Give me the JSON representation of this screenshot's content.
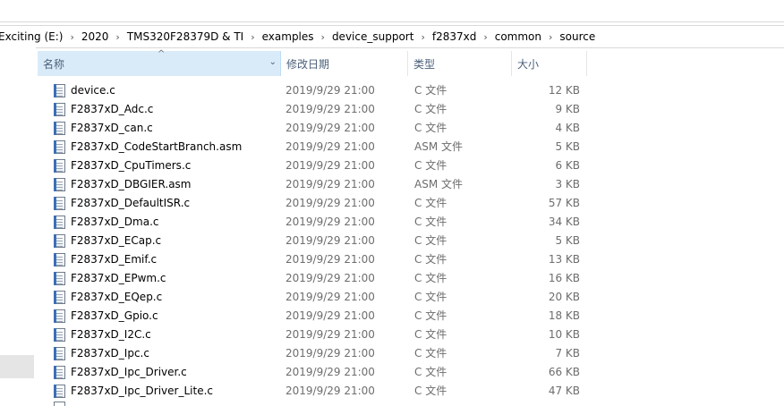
{
  "breadcrumb": [
    "Exciting (E:)",
    "2020",
    "TMS320F28379D & TI",
    "examples",
    "device_support",
    "f2837xd",
    "common",
    "source"
  ],
  "breadcrumb_separator": "›",
  "columns": {
    "name": "名称",
    "date": "修改日期",
    "type": "类型",
    "size": "大小"
  },
  "sort_indicator": "^",
  "files": [
    {
      "name": "device.c",
      "date": "2019/9/29 21:00",
      "type": "C 文件",
      "size": "12 KB"
    },
    {
      "name": "F2837xD_Adc.c",
      "date": "2019/9/29 21:00",
      "type": "C 文件",
      "size": "9 KB"
    },
    {
      "name": "F2837xD_can.c",
      "date": "2019/9/29 21:00",
      "type": "C 文件",
      "size": "4 KB"
    },
    {
      "name": "F2837xD_CodeStartBranch.asm",
      "date": "2019/9/29 21:00",
      "type": "ASM 文件",
      "size": "5 KB"
    },
    {
      "name": "F2837xD_CpuTimers.c",
      "date": "2019/9/29 21:00",
      "type": "C 文件",
      "size": "6 KB"
    },
    {
      "name": "F2837xD_DBGIER.asm",
      "date": "2019/9/29 21:00",
      "type": "ASM 文件",
      "size": "3 KB"
    },
    {
      "name": "F2837xD_DefaultISR.c",
      "date": "2019/9/29 21:00",
      "type": "C 文件",
      "size": "57 KB"
    },
    {
      "name": "F2837xD_Dma.c",
      "date": "2019/9/29 21:00",
      "type": "C 文件",
      "size": "34 KB"
    },
    {
      "name": "F2837xD_ECap.c",
      "date": "2019/9/29 21:00",
      "type": "C 文件",
      "size": "5 KB"
    },
    {
      "name": "F2837xD_Emif.c",
      "date": "2019/9/29 21:00",
      "type": "C 文件",
      "size": "13 KB"
    },
    {
      "name": "F2837xD_EPwm.c",
      "date": "2019/9/29 21:00",
      "type": "C 文件",
      "size": "16 KB"
    },
    {
      "name": "F2837xD_EQep.c",
      "date": "2019/9/29 21:00",
      "type": "C 文件",
      "size": "20 KB"
    },
    {
      "name": "F2837xD_Gpio.c",
      "date": "2019/9/29 21:00",
      "type": "C 文件",
      "size": "18 KB"
    },
    {
      "name": "F2837xD_I2C.c",
      "date": "2019/9/29 21:00",
      "type": "C 文件",
      "size": "10 KB"
    },
    {
      "name": "F2837xD_Ipc.c",
      "date": "2019/9/29 21:00",
      "type": "C 文件",
      "size": "7 KB"
    },
    {
      "name": "F2837xD_Ipc_Driver.c",
      "date": "2019/9/29 21:00",
      "type": "C 文件",
      "size": "66 KB"
    },
    {
      "name": "F2837xD_Ipc_Driver_Lite.c",
      "date": "2019/9/29 21:00",
      "type": "C 文件",
      "size": "47 KB"
    }
  ],
  "colors": {
    "header_selected_bg": "#d9ebf9",
    "header_text": "#4c607a",
    "secondary_text": "#6d6d6d"
  },
  "icons": {
    "file": "document-file-icon",
    "dropdown": "chevron-down-icon",
    "sort": "sort-ascending-icon"
  }
}
